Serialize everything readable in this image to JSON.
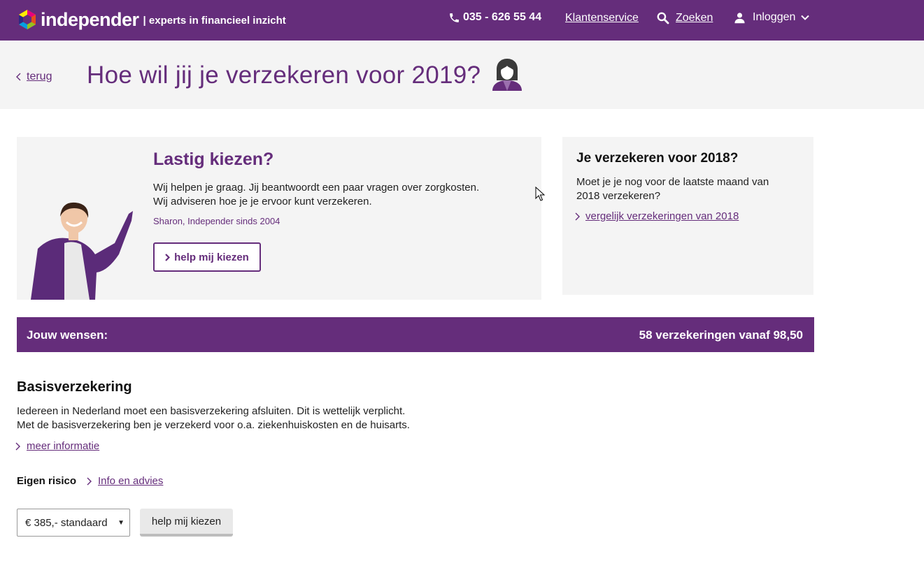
{
  "nav": {
    "logo_word": "independer",
    "tagline": "| experts in financieel inzicht",
    "phone": "035 - 626 55 44",
    "customer_service": "Klantenservice",
    "search": "Zoeken",
    "login": "Inloggen"
  },
  "header": {
    "back": "terug",
    "title": "Hoe wil jij je verzekeren voor 2019?"
  },
  "advice": {
    "title": "Lastig kiezen?",
    "line1": "Wij helpen je graag. Jij beantwoordt een paar vragen over zorgkosten.",
    "line2": "Wij adviseren hoe je je ervoor kunt verzekeren.",
    "signature": "Sharon, Independer sinds 2004",
    "button": "help mij kiezen"
  },
  "side": {
    "title": "Je verzekeren voor 2018?",
    "line1": "Moet je je nog voor de laatste maand van",
    "line2": "2018 verzekeren?",
    "link": "vergelijk verzekeringen van 2018"
  },
  "wishes": {
    "label": "Jouw wensen:",
    "summary": "58 verzekeringen vanaf 98,50"
  },
  "basis": {
    "title": "Basisverzekering",
    "line1": "Iedereen in Nederland moet een basisverzekering afsluiten. Dit is wettelijk verplicht.",
    "line2": "Met de basisverzekering ben je verzekerd voor o.a. ziekenhuiskosten en de huisarts.",
    "more": "meer informatie",
    "risk_label": "Eigen risico",
    "risk_link": "Info en advies",
    "select_value": "€ 385,- standaard",
    "help_button": "help mij kiezen"
  },
  "colors": {
    "brand_purple": "#652d7b",
    "panel_grey": "#f4f4f4"
  }
}
